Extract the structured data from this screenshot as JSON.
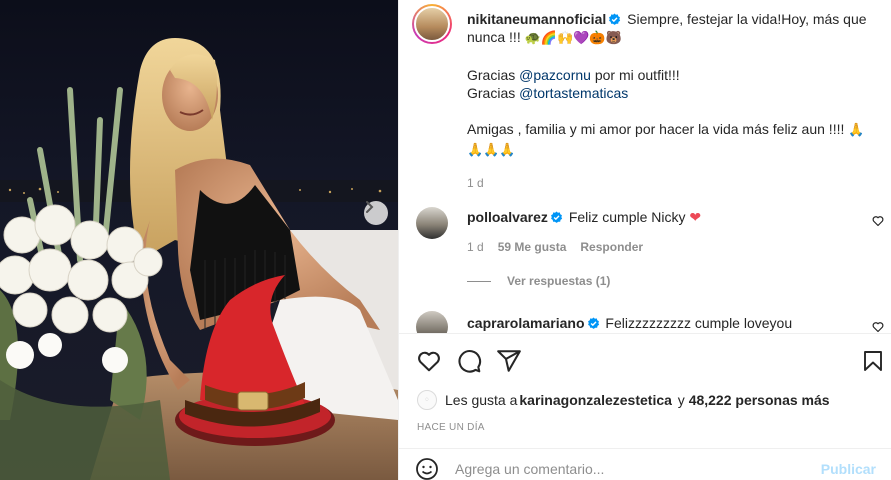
{
  "post": {
    "author": "nikitaneumannoficial",
    "caption_line1": "Siempre, festejar la vida!Hoy, más que nunca !!! ",
    "caption_emojis": "🐢🌈🙌💜🎃🐻",
    "thanks1_prefix": "Gracias ",
    "thanks1_mention": "@pazcornu",
    "thanks1_suffix": " por mi outfit!!!",
    "thanks2_prefix": "Gracias ",
    "thanks2_mention": "@tortastematicas",
    "friends_text": "Amigas , familia y mi amor por hacer la vida más feliz aun !!!! ",
    "friends_emojis": "🙏🙏🙏🙏",
    "age": "1 d"
  },
  "comments": [
    {
      "username": "polloalvarez",
      "text": "Feliz cumple Nicky ",
      "emoji": "❤",
      "age": "1 d",
      "likes": "59 Me gusta",
      "reply": "Responder",
      "view_replies": "Ver respuestas (1)"
    },
    {
      "username": "caprarolamariano",
      "text": "Felizzzzzzzzz cumple loveyou"
    }
  ],
  "actions": {
    "likes_prefix": "Les gusta a ",
    "likes_user": "karinagonzalezestetica",
    "likes_middle": " y ",
    "likes_count": "48,222 personas más",
    "timestamp": "HACE UN DÍA"
  },
  "add_comment": {
    "placeholder": "Agrega un comentario...",
    "publish": "Publicar"
  },
  "colors": {
    "verified": "#0095f6",
    "link": "#00376b",
    "heart_red": "#ed4956",
    "publish_disabled": "#b2dffc"
  }
}
